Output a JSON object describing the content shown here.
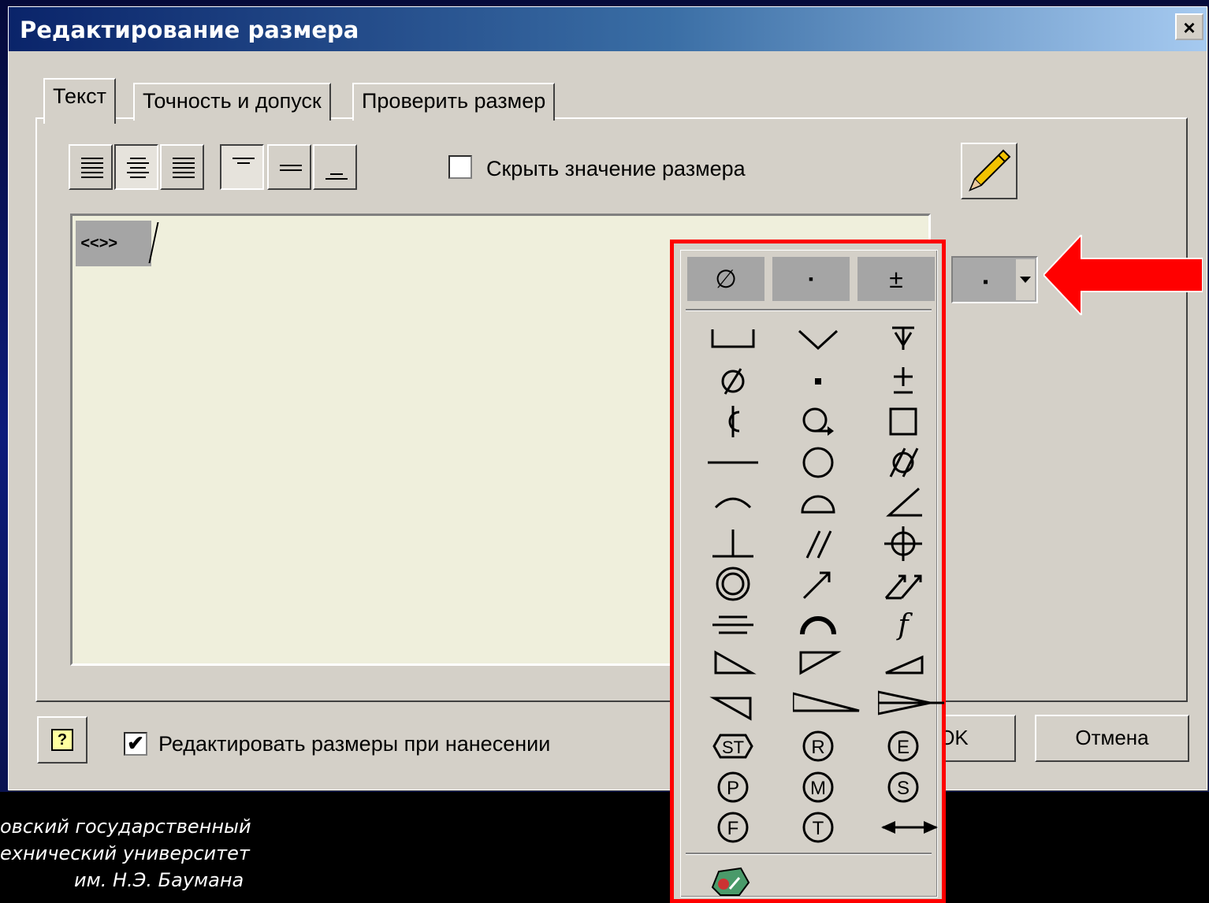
{
  "dialog": {
    "title": "Редактирование размера",
    "close_label": "×",
    "tabs": [
      "Текст",
      "Точность и допуск",
      "Проверить размер"
    ],
    "hide_value_label": "Скрыть значение размера",
    "hide_value_checked": false,
    "editor_token": "<<>>",
    "edit_on_place_label": "Редактировать размеры при нанесении",
    "edit_on_place_checked": true,
    "ok_label": "OK",
    "cancel_label": "Отмена",
    "help_label": "?",
    "symbol_dropdown_value": "▪"
  },
  "symbols": {
    "recent": [
      "∅",
      "▪",
      "±"
    ],
    "grid_icons": [
      [
        "counterbore-icon",
        "countersink-icon",
        "depth-icon"
      ],
      [
        "diameter-icon",
        "square-dot-icon",
        "plus-minus-icon"
      ],
      [
        "centerline-icon",
        "circular-runout-icon",
        "square-icon"
      ],
      [
        "flatness-icon",
        "circularity-icon",
        "cylindricity-icon"
      ],
      [
        "arc-length-icon",
        "profile-surface-icon",
        "angularity-icon"
      ],
      [
        "perpendicularity-icon",
        "parallelism-icon",
        "position-icon"
      ],
      [
        "concentricity-icon",
        "runout-arrow-icon",
        "total-runout-icon"
      ],
      [
        "symmetry-icon",
        "profile-line-icon",
        "function-icon"
      ],
      [
        "slope-right-icon",
        "slope-left-icon",
        "taper-small-icon"
      ],
      [
        "taper-left-icon",
        "taper-long-icon",
        "conical-taper-icon"
      ],
      [
        "statistical-icon",
        "regardless-icon",
        "envelope-icon"
      ],
      [
        "projected-zone-icon",
        "max-material-icon",
        "least-material-icon"
      ],
      [
        "free-state-icon",
        "tangent-plane-icon",
        "between-icon"
      ]
    ],
    "circled_labels": {
      "statistical": "ST",
      "regardless": "R",
      "envelope": "E",
      "projected": "P",
      "max_material": "M",
      "least_material": "S",
      "free_state": "F",
      "tangent": "T",
      "function": "f"
    }
  },
  "footer": {
    "line1": "овский государственный",
    "line2": "ехнический университет",
    "line3": "им. Н.Э. Баумана"
  },
  "colors": {
    "accent_red": "#ff0000",
    "title_bar_start": "#0a246a",
    "title_bar_end": "#a6caf0",
    "dialog_bg": "#d4d0c8",
    "editor_bg": "#efefdc"
  }
}
